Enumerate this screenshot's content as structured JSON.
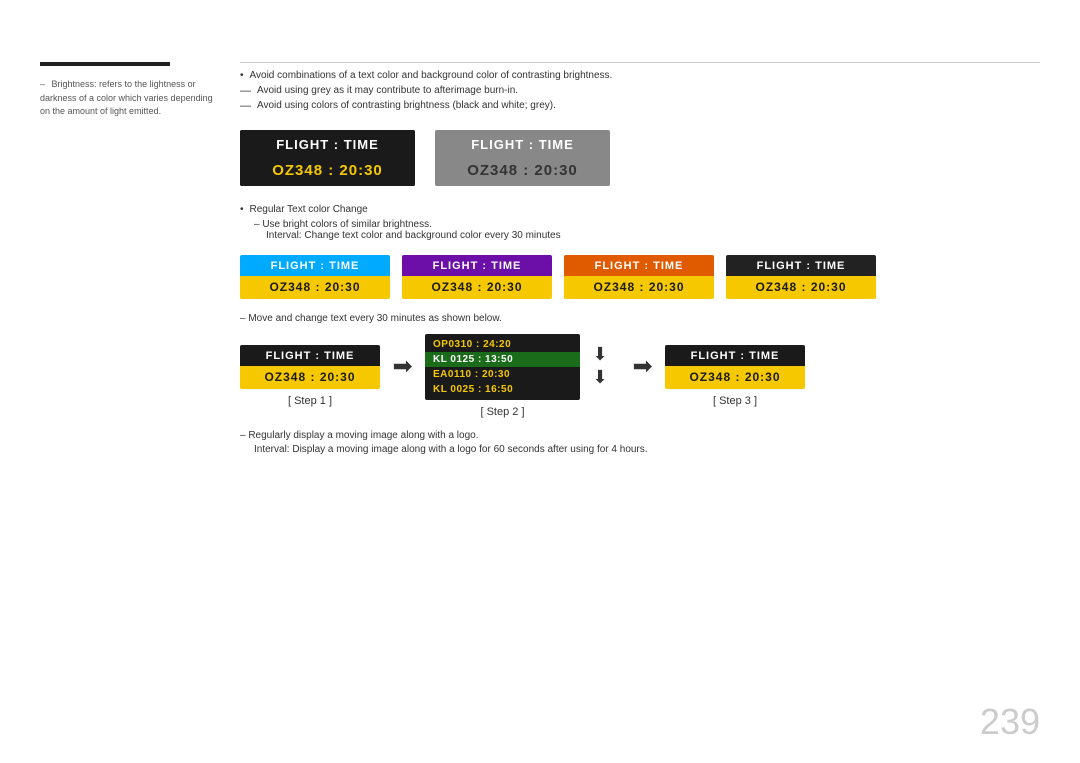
{
  "sidebar": {
    "bar_present": true,
    "dash": "–",
    "text": "Brightness: refers to the lightness or darkness of a color which varies depending on the amount of light emitted."
  },
  "main": {
    "bullets": [
      {
        "type": "bullet",
        "text": "Avoid combinations of a text color and background color of contrasting brightness."
      },
      {
        "type": "dash",
        "text": "Avoid using grey as it may contribute to afterimage burn-in."
      },
      {
        "type": "dash",
        "text": "Avoid using colors of contrasting brightness (black and white; grey)."
      }
    ],
    "panel1": {
      "header": "FLIGHT  :  TIME",
      "body": "OZ348  :  20:30",
      "bg": "#1a1a1a",
      "header_color": "#ffffff",
      "body_color": "#f5c800"
    },
    "panel2": {
      "header": "FLIGHT  :  TIME",
      "body": "OZ348  :  20:30",
      "bg": "#888888",
      "header_color": "#ffffff",
      "body_color": "#333333"
    },
    "sub_section": {
      "title": "Regular Text color Change",
      "dash1": "–  Use bright colors of similar brightness.",
      "dash2": "    Interval: Change text color and background color every 30 minutes"
    },
    "four_panels": [
      {
        "header_bg": "#00aaff",
        "body_bg": "#f5c800",
        "header_text": "FLIGHT  :  TIME",
        "body_text": "OZ348  :  20:30",
        "body_text_color": "#1a1a1a"
      },
      {
        "header_bg": "#6b0fa8",
        "body_bg": "#f5c800",
        "header_text": "FLIGHT  :  TIME",
        "body_text": "OZ348  :  20:30",
        "body_text_color": "#1a1a1a"
      },
      {
        "header_bg": "#e05a00",
        "body_bg": "#f5c800",
        "header_text": "FLIGHT  :  TIME",
        "body_text": "OZ348  :  20:30",
        "body_text_color": "#1a1a1a"
      },
      {
        "header_bg": "#222222",
        "body_bg": "#f5c800",
        "header_text": "FLIGHT  :  TIME",
        "body_text": "OZ348  :  20:30",
        "body_text_color": "#1a1a1a"
      }
    ],
    "move_note": "–   Move and change text every 30 minutes as shown below.",
    "steps": [
      {
        "label": "[ Step 1 ]",
        "type": "normal",
        "header_bg": "#1a1a1a",
        "body_bg": "#f5c800",
        "header_text": "FLIGHT  :  TIME",
        "body_text": "OZ348  :  20:30",
        "body_text_color": "#1a1a1a"
      },
      {
        "label": "[ Step 2 ]",
        "type": "scroll",
        "rows": [
          {
            "text": "OP0310 :  24:20",
            "color": "#f5c800"
          },
          {
            "text": "KL 0125 :  13:50",
            "color": "#ffffff",
            "bg": "#1a6b1a"
          },
          {
            "text": "EA0110 :  20:30",
            "color": "#f5c800"
          },
          {
            "text": "KL 0025 :  16:50",
            "color": "#f5c800"
          }
        ]
      },
      {
        "label": "[ Step 3 ]",
        "type": "normal",
        "header_bg": "#1a1a1a",
        "body_bg": "#f5c800",
        "header_text": "FLIGHT  :  TIME",
        "body_text": "OZ348  :  20:30",
        "body_text_color": "#1a1a1a"
      }
    ],
    "bottom_notes": [
      "–   Regularly display a moving image along with a logo.",
      "    Interval: Display a moving image along with a logo for 60 seconds after using for 4 hours."
    ],
    "page_number": "239"
  }
}
